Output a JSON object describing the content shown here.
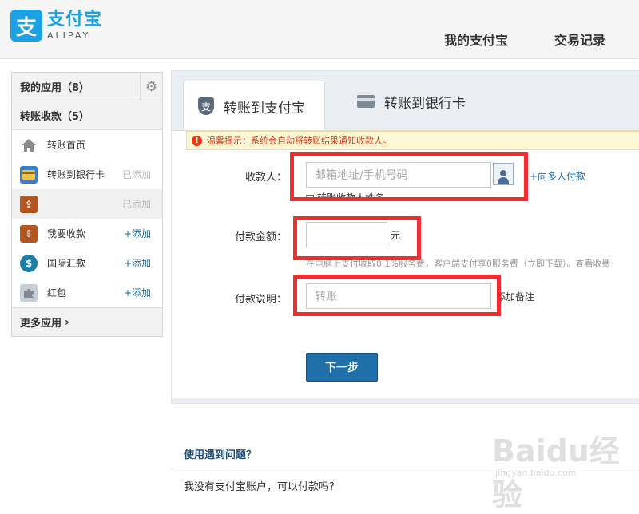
{
  "header": {
    "logo_mark": "支",
    "logo_cn": "支付宝",
    "logo_en": "ALIPAY",
    "nav": [
      "我的支付宝",
      "交易记录"
    ]
  },
  "sidebar": {
    "my_apps": "我的应用（8）",
    "transfer_section": "转账收款（5）",
    "items": [
      {
        "label": "转账首页",
        "status": "",
        "icon": "home-icon",
        "color": "#8a8a8a"
      },
      {
        "label": "转账到银行卡",
        "status": "已添加",
        "icon": "bank-card-icon",
        "color": "#3d7fc4"
      },
      {
        "label": "",
        "status": "已添加",
        "icon": "upload-wallet-icon",
        "color": "#b3551f"
      },
      {
        "label": "我要收款",
        "status": "+添加",
        "icon": "receive-wallet-icon",
        "color": "#b3551f"
      },
      {
        "label": "国际汇款",
        "status": "+添加",
        "icon": "currency-icon",
        "color": "#1b7fa5"
      },
      {
        "label": "红包",
        "status": "+添加",
        "icon": "puzzle-icon",
        "color": "#9aa3ad"
      }
    ],
    "more": "更多应用"
  },
  "tabs": {
    "alipay_label": "转账到支付宝",
    "alipay_icon": "支",
    "bank_label": "转账到银行卡"
  },
  "tip": {
    "icon": "!",
    "text": "温馨提示：系统会自动将转账结果通知收款人。"
  },
  "form": {
    "recipient_label": "收款人：",
    "recipient_placeholder": "邮箱地址/手机号码",
    "multi_pay_link": "+向多人付款",
    "save_contact": "转账收款人姓名",
    "amount_label": "付款金额：",
    "amount_value": "",
    "amount_unit": "元",
    "fee_hint": "在电脑上支付收取0.1%服务费，客户端支付享0服务费（立即下载）。查看收费",
    "note_label": "付款说明：",
    "note_placeholder": "转账",
    "add_remark": "添加备注",
    "next_button": "下一步"
  },
  "faq": {
    "title": "使用遇到问题？",
    "question": "我没有支付宝账户，可以付款吗?"
  },
  "watermark": {
    "main": "Baidu经验",
    "sub": "jingyan.baidu.com"
  },
  "colors": {
    "highlight": "#ef2f2f",
    "brand": "#1ba1e6",
    "link": "#1a6ea8"
  }
}
